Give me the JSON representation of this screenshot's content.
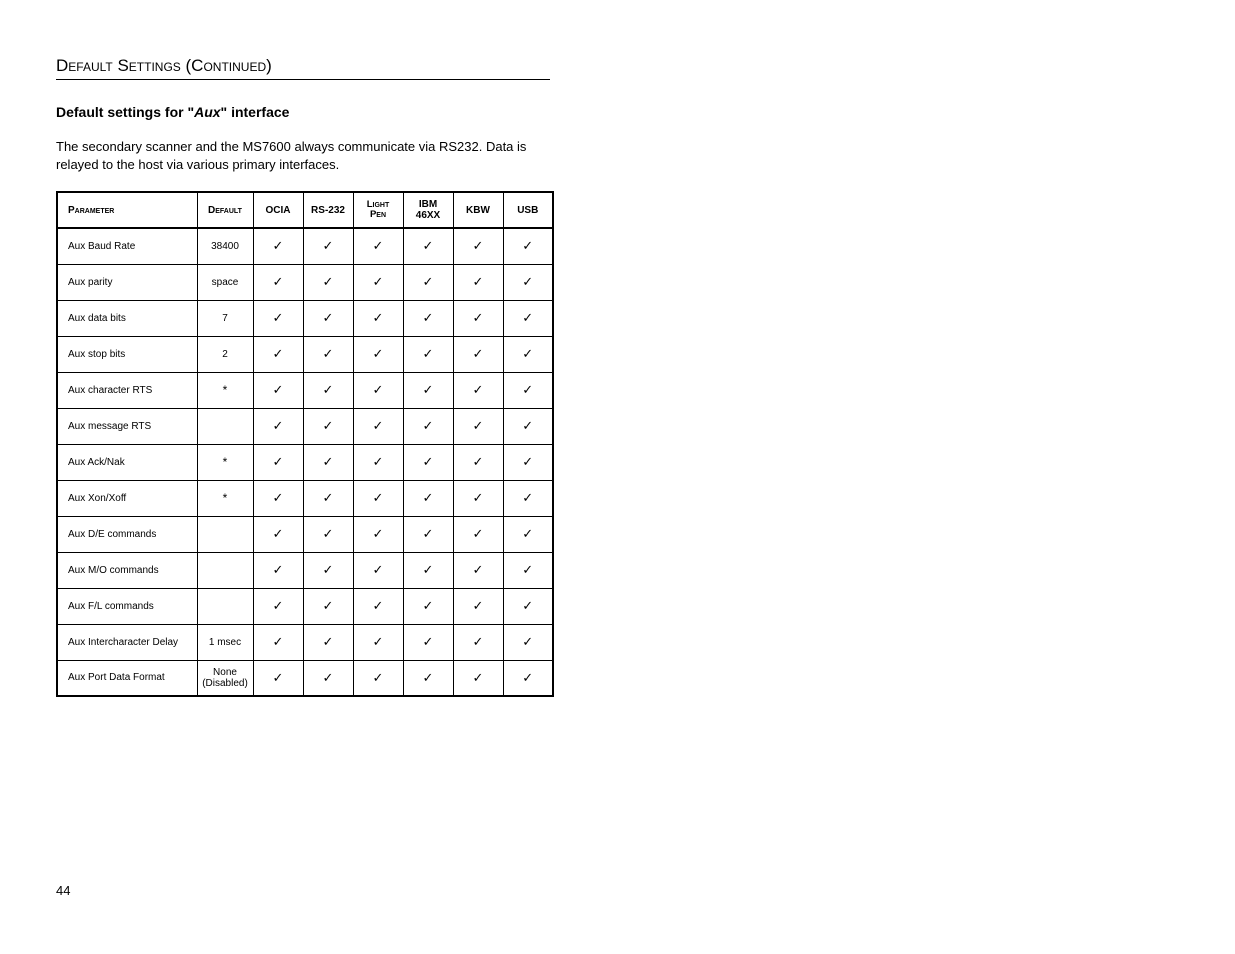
{
  "page": {
    "header": "Default Settings (Continued)",
    "subtitle_prefix": "Default settings for \"",
    "subtitle_italic": "Aux",
    "subtitle_suffix": "\" interface",
    "intro": "The secondary scanner and the MS7600 always communicate via RS232.  Data is relayed to the host via various primary interfaces.",
    "page_number": "44"
  },
  "table": {
    "headers": [
      "Parameter",
      "Default",
      "OCIA",
      "RS-232",
      "Light Pen",
      "IBM 46XX",
      "KBW",
      "USB"
    ],
    "check": "✓",
    "star": "*",
    "rows": [
      {
        "param": "Aux Baud Rate",
        "default": "38400",
        "cols": [
          true,
          true,
          true,
          true,
          true,
          true
        ]
      },
      {
        "param": "Aux parity",
        "default": "space",
        "cols": [
          true,
          true,
          true,
          true,
          true,
          true
        ]
      },
      {
        "param": "Aux data bits",
        "default": "7",
        "cols": [
          true,
          true,
          true,
          true,
          true,
          true
        ]
      },
      {
        "param": "Aux stop bits",
        "default": "2",
        "cols": [
          true,
          true,
          true,
          true,
          true,
          true
        ]
      },
      {
        "param": "Aux character RTS",
        "default": "*",
        "cols": [
          true,
          true,
          true,
          true,
          true,
          true
        ]
      },
      {
        "param": "Aux message RTS",
        "default": "",
        "cols": [
          true,
          true,
          true,
          true,
          true,
          true
        ]
      },
      {
        "param": "Aux Ack/Nak",
        "default": "*",
        "cols": [
          true,
          true,
          true,
          true,
          true,
          true
        ]
      },
      {
        "param": "Aux Xon/Xoff",
        "default": "*",
        "cols": [
          true,
          true,
          true,
          true,
          true,
          true
        ]
      },
      {
        "param": "Aux D/E commands",
        "default": "",
        "cols": [
          true,
          true,
          true,
          true,
          true,
          true
        ]
      },
      {
        "param": "Aux M/O commands",
        "default": "",
        "cols": [
          true,
          true,
          true,
          true,
          true,
          true
        ]
      },
      {
        "param": "Aux F/L commands",
        "default": "",
        "cols": [
          true,
          true,
          true,
          true,
          true,
          true
        ]
      },
      {
        "param": "Aux Intercharacter Delay",
        "default": "1 msec",
        "cols": [
          true,
          true,
          true,
          true,
          true,
          true
        ]
      },
      {
        "param": "Aux Port Data Format",
        "default": "None (Disabled)",
        "cols": [
          true,
          true,
          true,
          true,
          true,
          true
        ]
      }
    ]
  }
}
